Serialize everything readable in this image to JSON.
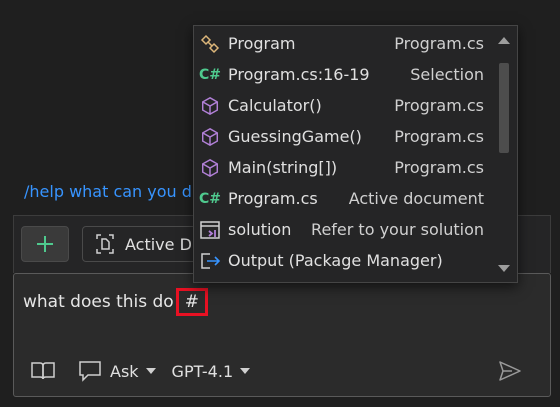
{
  "help_text": "/help what can you d",
  "context_bar": {
    "active_doc_label": "Active D"
  },
  "input": {
    "prompt": "what does this do",
    "hash": "#"
  },
  "bottom_bar": {
    "mode_label": "Ask",
    "model_label": "GPT-4.1"
  },
  "dropdown": {
    "items": [
      {
        "icon": "class-icon",
        "name": "Program",
        "detail": "Program.cs"
      },
      {
        "icon": "csharp-file-icon",
        "name": "Program.cs:16-19",
        "detail": "Selection"
      },
      {
        "icon": "method-icon",
        "name": "Calculator()",
        "detail": "Program.cs"
      },
      {
        "icon": "method-icon",
        "name": "GuessingGame()",
        "detail": "Program.cs"
      },
      {
        "icon": "method-icon",
        "name": "Main(string[])",
        "detail": "Program.cs"
      },
      {
        "icon": "csharp-file-icon",
        "name": "Program.cs",
        "detail": "Active document"
      },
      {
        "icon": "solution-icon",
        "name": "solution",
        "detail": "Refer to your solution"
      },
      {
        "icon": "output-icon",
        "name": "Output (Package Manager)",
        "detail": ""
      }
    ]
  },
  "colors": {
    "accent_link": "#3794ff",
    "method_purple": "#b180d7",
    "csharp_green": "#4fc98e",
    "highlight_red": "#e81123",
    "class_gold": "#dcb67a"
  }
}
